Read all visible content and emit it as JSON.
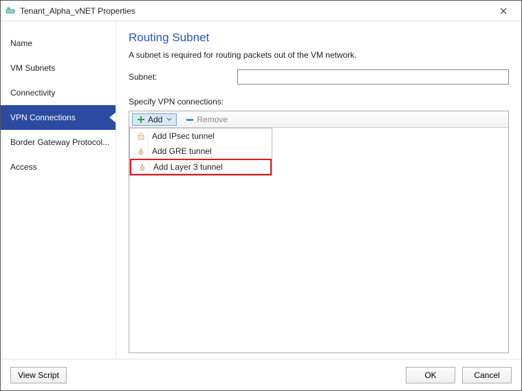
{
  "window": {
    "title": "Tenant_Alpha_vNET Properties"
  },
  "sidebar": {
    "items": [
      {
        "label": "Name"
      },
      {
        "label": "VM Subnets"
      },
      {
        "label": "Connectivity"
      },
      {
        "label": "VPN Connections",
        "selected": true
      },
      {
        "label": "Border Gateway Protocol..."
      },
      {
        "label": "Access"
      }
    ]
  },
  "main": {
    "heading": "Routing Subnet",
    "description": "A subnet is required for routing packets out of the VM network.",
    "subnet_label": "Subnet:",
    "subnet_value": "",
    "specify_label": "Specify VPN connections:",
    "toolbar": {
      "add_label": "Add",
      "remove_label": "Remove"
    },
    "add_menu": {
      "items": [
        {
          "label": "Add IPsec tunnel"
        },
        {
          "label": "Add GRE tunnel"
        },
        {
          "label": "Add Layer 3 tunnel",
          "highlight": true
        }
      ]
    }
  },
  "footer": {
    "view_script": "View Script",
    "ok": "OK",
    "cancel": "Cancel"
  }
}
